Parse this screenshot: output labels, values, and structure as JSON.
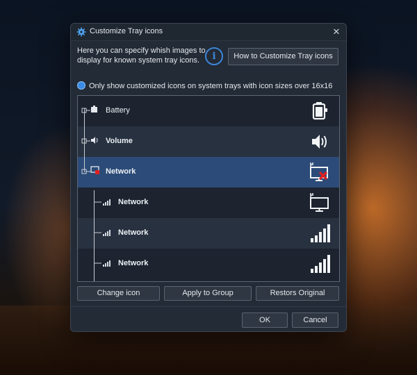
{
  "window": {
    "title": "Customize Tray icons",
    "close_glyph": "✕"
  },
  "description": "Here you can specify whish images to display for known system tray icons.",
  "info_glyph": "i",
  "howto_button": "How to Customize Tray icons",
  "radio_option": "Only show customized icons on system trays with icon sizes over 16x16",
  "tray_items": [
    {
      "label": "Battery",
      "icon": "battery-icon"
    },
    {
      "label": "Volume",
      "icon": "volume-icon"
    },
    {
      "label": "Network",
      "icon": "network-disconnected-icon",
      "selected": true
    },
    {
      "label": "Network",
      "icon": "network-monitor-icon"
    },
    {
      "label": "Network",
      "icon": "signal-bars-icon"
    },
    {
      "label": "Network",
      "icon": "signal-bars-icon"
    }
  ],
  "buttons": {
    "change_icon": "Change icon",
    "apply_group": "Apply to Group",
    "restore": "Restors Original",
    "ok": "OK",
    "cancel": "Cancel"
  },
  "colors": {
    "accent": "#3d86d8",
    "selection": "#2c4b78",
    "error": "#e02020"
  }
}
